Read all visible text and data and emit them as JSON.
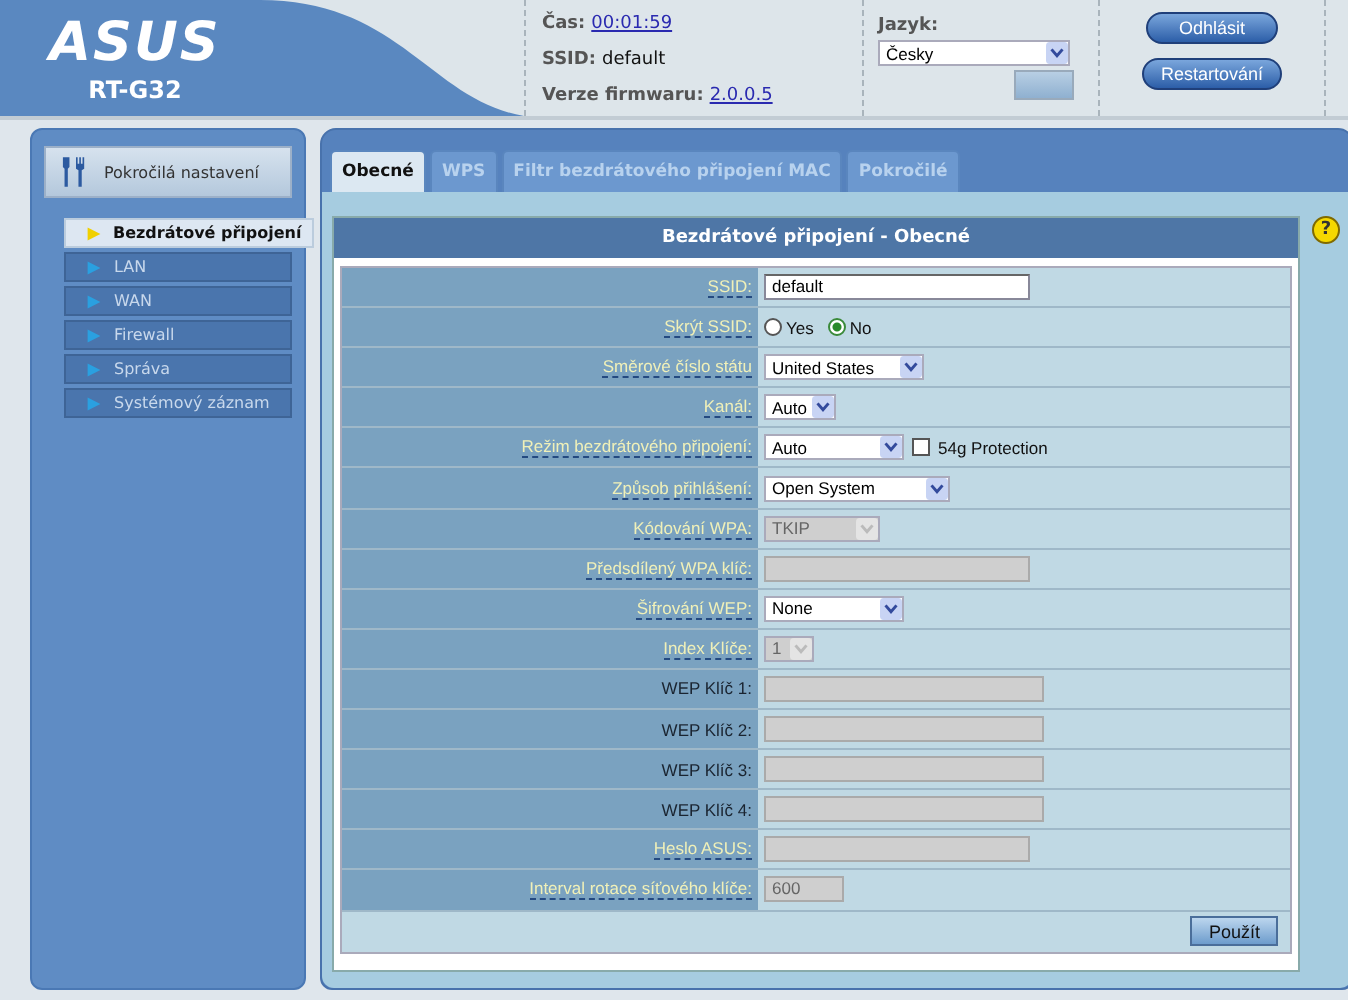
{
  "header": {
    "logo": "ASUS",
    "model": "RT-G32",
    "time_label": "Čas:",
    "time": "00:01:59",
    "ssid_label": "SSID:",
    "ssid": "default",
    "firmware_label": "Verze firmwaru:",
    "firmware": "2.0.0.5",
    "language_label": "Jazyk:",
    "language": "Česky",
    "buttons": [
      "Odhlásit",
      "Restartování"
    ]
  },
  "sidebar": {
    "title": "Pokročilá nastavení",
    "items": [
      {
        "label": "Bezdrátové připojení",
        "selected": true
      },
      {
        "label": "LAN",
        "selected": false
      },
      {
        "label": "WAN",
        "selected": false
      },
      {
        "label": "Firewall",
        "selected": false
      },
      {
        "label": "Správa",
        "selected": false
      },
      {
        "label": "Systémový záznam",
        "selected": false
      }
    ]
  },
  "tabs": [
    {
      "label": "Obecné",
      "selected": true
    },
    {
      "label": "WPS",
      "selected": false
    },
    {
      "label": "Filtr bezdrátového připojení MAC",
      "selected": false
    },
    {
      "label": "Pokročilé",
      "selected": false
    }
  ],
  "panel": {
    "title": "Bezdrátové připojení - Obecné",
    "help": "?",
    "rows": [
      {
        "label": "SSID:",
        "hint": true,
        "kind": "text",
        "value": "default",
        "disabled": false
      },
      {
        "label": "Skrýt SSID:",
        "hint": true,
        "kind": "radio",
        "options": [
          {
            "label": "Yes",
            "selected": false
          },
          {
            "label": "No",
            "selected": true
          }
        ]
      },
      {
        "label": "Směrové číslo státu",
        "hint": true,
        "kind": "select",
        "value": "United States",
        "disabled": false
      },
      {
        "label": "Kanál:",
        "hint": true,
        "kind": "select",
        "value": "Auto",
        "disabled": false
      },
      {
        "label": "Režim bezdrátového připojení:",
        "hint": true,
        "kind": "select",
        "value": "Auto",
        "disabled": false,
        "checkbox": {
          "label": "54g Protection",
          "checked": false
        }
      },
      {
        "label": "Způsob přihlášení:",
        "hint": true,
        "kind": "select",
        "value": "Open System",
        "disabled": false
      },
      {
        "label": "Kódování WPA:",
        "hint": true,
        "kind": "select",
        "value": "TKIP",
        "disabled": true
      },
      {
        "label": "Předsdílený WPA klíč:",
        "hint": true,
        "kind": "text",
        "disabled": true
      },
      {
        "label": "Šifrování WEP:",
        "hint": true,
        "kind": "select",
        "value": "None",
        "disabled": false
      },
      {
        "label": "Index Klíče:",
        "hint": true,
        "kind": "select",
        "value": "1",
        "disabled": true
      },
      {
        "label": "WEP Klíč 1:",
        "hint": false,
        "kind": "text",
        "disabled": true
      },
      {
        "label": "WEP Klíč 2:",
        "hint": false,
        "kind": "text",
        "disabled": true
      },
      {
        "label": "WEP Klíč 3:",
        "hint": false,
        "kind": "text",
        "disabled": true
      },
      {
        "label": "WEP Klíč 4:",
        "hint": false,
        "kind": "text",
        "disabled": true
      },
      {
        "label": "Heslo ASUS:",
        "hint": true,
        "kind": "text",
        "disabled": true
      },
      {
        "label": "Interval rotace síťového klíče:",
        "hint": true,
        "kind": "text",
        "value": "600",
        "disabled": true
      }
    ],
    "apply": "Použít"
  }
}
